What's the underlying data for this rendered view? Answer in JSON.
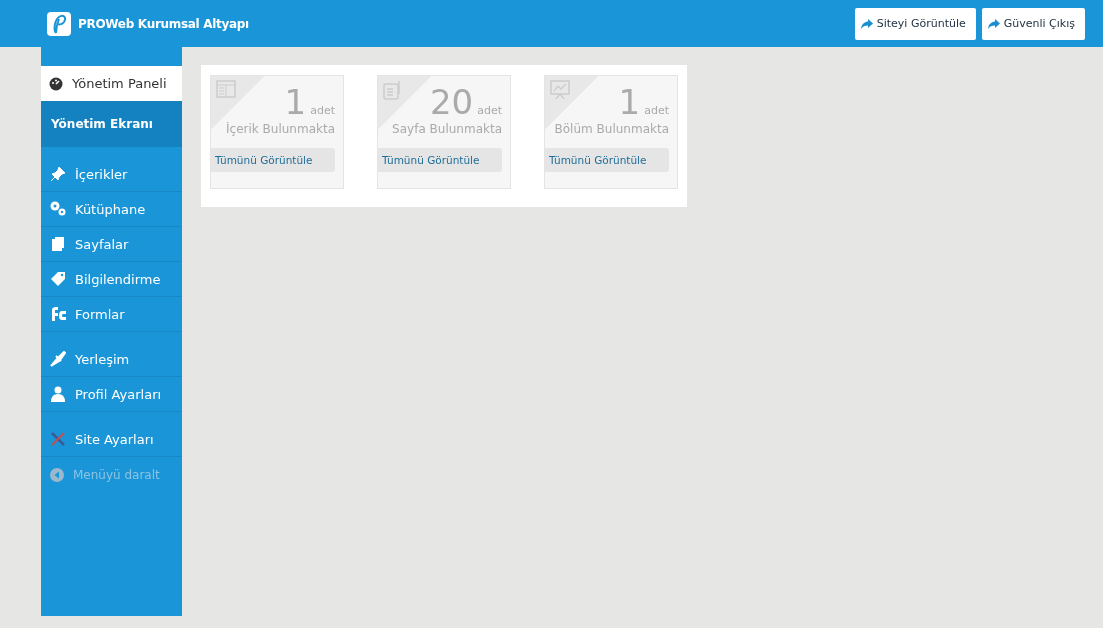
{
  "header": {
    "title": "PROWeb Kurumsal Altyapı",
    "buttons": [
      "Siteyi Görüntüle",
      "Güvenli Çıkış"
    ]
  },
  "sidebar": {
    "panel": {
      "label": "Yönetim Paneli",
      "selected": true
    },
    "section": "Yönetim Ekranı",
    "groups": [
      {
        "items": [
          {
            "label": "İçerikler",
            "kind": "pin"
          },
          {
            "label": "Kütüphane",
            "kind": "library"
          },
          {
            "label": "Sayfalar",
            "kind": "pages"
          },
          {
            "label": "Bilgilendirme",
            "kind": "tag"
          },
          {
            "label": "Formlar",
            "kind": "forms"
          }
        ]
      },
      {
        "items": [
          {
            "label": "Yerleşim",
            "kind": "brush"
          },
          {
            "label": "Profil Ayarları",
            "kind": "user"
          }
        ]
      },
      {
        "items": [
          {
            "label": "Site Ayarları",
            "kind": "tools"
          }
        ]
      }
    ],
    "collapse": {
      "label": "Menüyü daralt",
      "disabled": true
    }
  },
  "cards": [
    {
      "kind": "content",
      "count": "1",
      "unit": "adet",
      "caption": "İçerik Bulunmakta",
      "link": "Tümünü Görüntüle"
    },
    {
      "kind": "page",
      "count": "20",
      "unit": "adet",
      "caption": "Sayfa Bulunmakta",
      "link": "Tümünü Görüntüle"
    },
    {
      "kind": "section",
      "count": "1",
      "unit": "adet",
      "caption": "Bölüm Bulunmakta",
      "link": "Tümünü Görüntüle"
    }
  ]
}
